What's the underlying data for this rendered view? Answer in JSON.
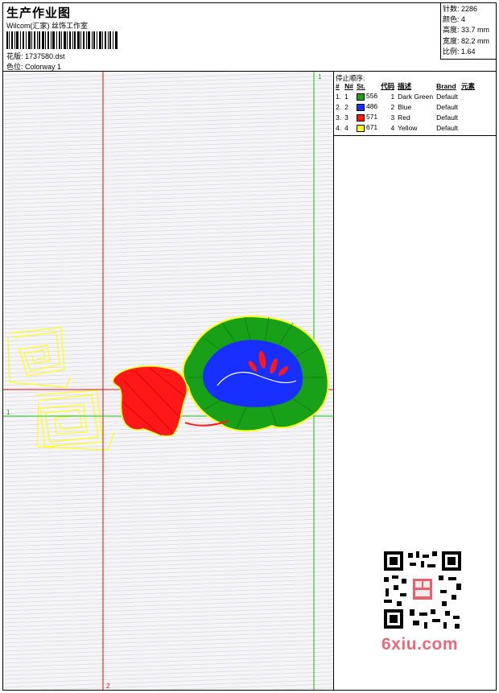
{
  "header": {
    "title": "生产作业图",
    "subtitle": "Wilcom(汇家) 丝饰工作室",
    "file": "花版: 1737580.dst",
    "colorway": "色位: Colorway 1"
  },
  "stats": [
    {
      "label": "针数",
      "value": "2286"
    },
    {
      "label": "颜色",
      "value": "4"
    },
    {
      "label": "高度",
      "value": "33.7 mm"
    },
    {
      "label": "宽度",
      "value": "82.2 mm"
    },
    {
      "label": "比例",
      "value": "1.64"
    }
  ],
  "legend": {
    "heading": "停止顺序:",
    "columns": [
      "#",
      "N#",
      "St.",
      "代码",
      "描述",
      "Brand",
      "元素"
    ],
    "rows": [
      {
        "idx": "1.",
        "n": "1",
        "st": "556",
        "code": "1",
        "desc": "Dark Green",
        "brand": "Default",
        "color": "#18a018"
      },
      {
        "idx": "2.",
        "n": "2",
        "st": "486",
        "code": "2",
        "desc": "Blue",
        "brand": "Default",
        "color": "#1830ff"
      },
      {
        "idx": "3.",
        "n": "3",
        "st": "571",
        "code": "3",
        "desc": "Red",
        "brand": "Default",
        "color": "#ff1818"
      },
      {
        "idx": "4.",
        "n": "4",
        "st": "671",
        "code": "4",
        "desc": "Yellow",
        "brand": "Default",
        "color": "#ffff18"
      }
    ]
  },
  "guides": {
    "vertical_red_label": "2",
    "vertical_green_label": "1",
    "horizontal_green_label": "1"
  },
  "watermark": {
    "text": "6xiu.com",
    "icon": "qr-code-icon"
  },
  "colors": {
    "green": "#18a018",
    "blue": "#1830ff",
    "red": "#ff1818",
    "yellow": "#ffff18"
  }
}
